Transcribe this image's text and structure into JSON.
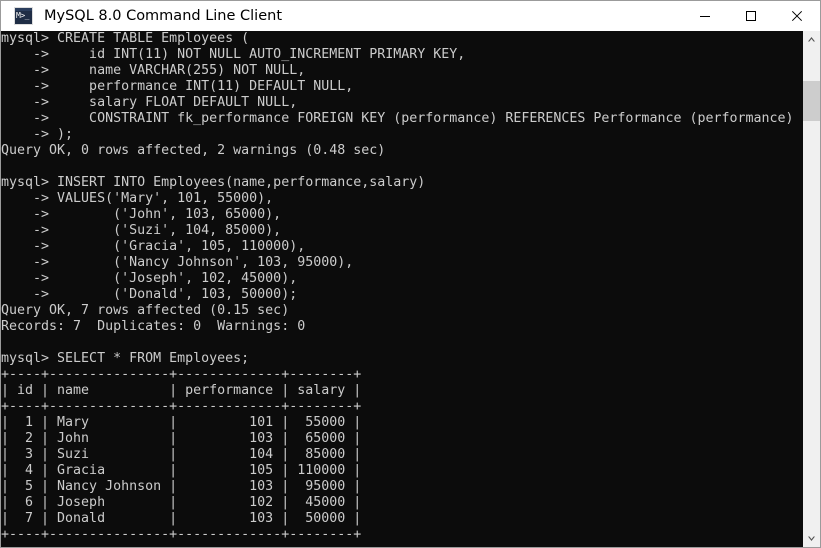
{
  "window": {
    "title": "MySQL 8.0 Command Line Client",
    "icon": "mysql-console-icon",
    "icon_glyph": "M>_",
    "background_color": "#0c0c0c",
    "text_color": "#cccccc",
    "titlebar_color": "#ffffff"
  },
  "controls": {
    "minimize": "minimize-button",
    "maximize": "maximize-button",
    "close": "close-button"
  },
  "scrollbar": {
    "up_arrow": "scroll-up-arrow",
    "down_arrow": "scroll-down-arrow",
    "thumb": "scrollbar-thumb"
  },
  "terminal": {
    "prompt": "mysql>",
    "continuation": "    ->",
    "lines": [
      "mysql> CREATE TABLE Employees (",
      "    ->     id INT(11) NOT NULL AUTO_INCREMENT PRIMARY KEY,",
      "    ->     name VARCHAR(255) NOT NULL,",
      "    ->     performance INT(11) DEFAULT NULL,",
      "    ->     salary FLOAT DEFAULT NULL,",
      "    ->     CONSTRAINT fk_performance FOREIGN KEY (performance) REFERENCES Performance (performance)",
      "    -> );",
      "Query OK, 0 rows affected, 2 warnings (0.48 sec)",
      "",
      "mysql> INSERT INTO Employees(name,performance,salary)",
      "    -> VALUES('Mary', 101, 55000),",
      "    ->        ('John', 103, 65000),",
      "    ->        ('Suzi', 104, 85000),",
      "    ->        ('Gracia', 105, 110000),",
      "    ->        ('Nancy Johnson', 103, 95000),",
      "    ->        ('Joseph', 102, 45000),",
      "    ->        ('Donald', 103, 50000);",
      "Query OK, 7 rows affected (0.15 sec)",
      "Records: 7  Duplicates: 0  Warnings: 0",
      "",
      "mysql> SELECT * FROM Employees;",
      "+----+---------------+-------------+--------+",
      "| id | name          | performance | salary |",
      "+----+---------------+-------------+--------+",
      "|  1 | Mary          |         101 |  55000 |",
      "|  2 | John          |         103 |  65000 |",
      "|  3 | Suzi          |         104 |  85000 |",
      "|  4 | Gracia        |         105 | 110000 |",
      "|  5 | Nancy Johnson |         103 |  95000 |",
      "|  6 | Joseph        |         102 |  45000 |",
      "|  7 | Donald        |         103 |  50000 |",
      "+----+---------------+-------------+--------+"
    ]
  },
  "statements": {
    "create_table": {
      "table": "Employees",
      "columns": [
        "id INT(11) NOT NULL AUTO_INCREMENT PRIMARY KEY",
        "name VARCHAR(255) NOT NULL",
        "performance INT(11) DEFAULT NULL",
        "salary FLOAT DEFAULT NULL",
        "CONSTRAINT fk_performance FOREIGN KEY (performance) REFERENCES Performance (performance)"
      ],
      "result": "Query OK, 0 rows affected, 2 warnings (0.48 sec)"
    },
    "insert": {
      "table": "Employees",
      "columns": [
        "name",
        "performance",
        "salary"
      ],
      "values": [
        [
          "'Mary'",
          "101",
          "55000"
        ],
        [
          "'John'",
          "103",
          "65000"
        ],
        [
          "'Suzi'",
          "104",
          "85000"
        ],
        [
          "'Gracia'",
          "105",
          "110000"
        ],
        [
          "'Nancy Johnson'",
          "103",
          "95000"
        ],
        [
          "'Joseph'",
          "102",
          "45000"
        ],
        [
          "'Donald'",
          "103",
          "50000"
        ]
      ],
      "result": "Query OK, 7 rows affected (0.15 sec)",
      "summary": "Records: 7  Duplicates: 0  Warnings: 0"
    },
    "select": {
      "query": "SELECT * FROM Employees;",
      "headers": [
        "id",
        "name",
        "performance",
        "salary"
      ],
      "rows": [
        [
          "1",
          "Mary",
          "101",
          "55000"
        ],
        [
          "2",
          "John",
          "103",
          "65000"
        ],
        [
          "3",
          "Suzi",
          "104",
          "85000"
        ],
        [
          "4",
          "Gracia",
          "105",
          "110000"
        ],
        [
          "5",
          "Nancy Johnson",
          "103",
          "95000"
        ],
        [
          "6",
          "Joseph",
          "102",
          "45000"
        ],
        [
          "7",
          "Donald",
          "103",
          "50000"
        ]
      ]
    }
  }
}
